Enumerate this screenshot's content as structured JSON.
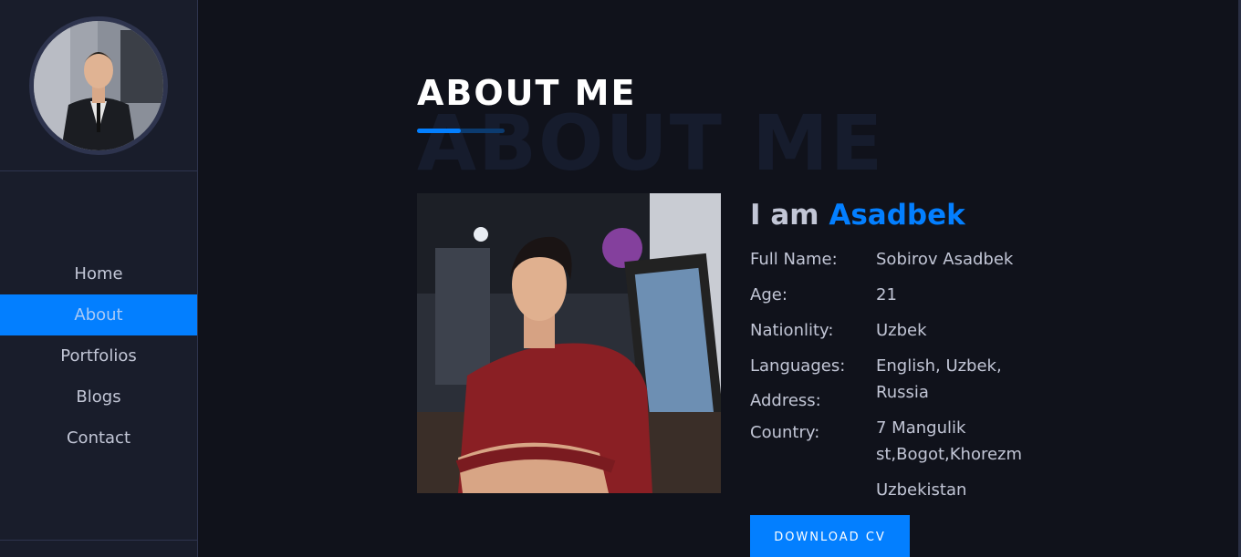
{
  "sidebar": {
    "nav": [
      {
        "label": "Home",
        "active": false
      },
      {
        "label": "About",
        "active": true
      },
      {
        "label": "Portfolios",
        "active": false
      },
      {
        "label": "Blogs",
        "active": false
      },
      {
        "label": "Contact",
        "active": false
      }
    ]
  },
  "about": {
    "title": "ABOUT ME",
    "title_bg": "ABOUT ME",
    "heading_prefix": "I am ",
    "heading_name": "Asadbek",
    "fields": [
      {
        "label": "Full Name:",
        "value": "Sobirov Asadbek"
      },
      {
        "label": "Age:",
        "value": "21"
      },
      {
        "label": "Nationlity:",
        "value": "Uzbek"
      },
      {
        "label": "Languages:",
        "value": "English, Uzbek,"
      },
      {
        "label": "Address:",
        "value": "Russia"
      },
      {
        "label": "Country:",
        "value": "7 Mangulik"
      },
      {
        "label": "",
        "value": "st,Bogot,Khorezm"
      },
      {
        "label": "",
        "value": "Uzbekistan"
      }
    ],
    "cv_button": "DOWNLOAD CV"
  },
  "colors": {
    "accent": "#037fff",
    "sidebar_bg": "#191d2b",
    "page_bg": "#10121b",
    "text": "#c2c6d6"
  }
}
